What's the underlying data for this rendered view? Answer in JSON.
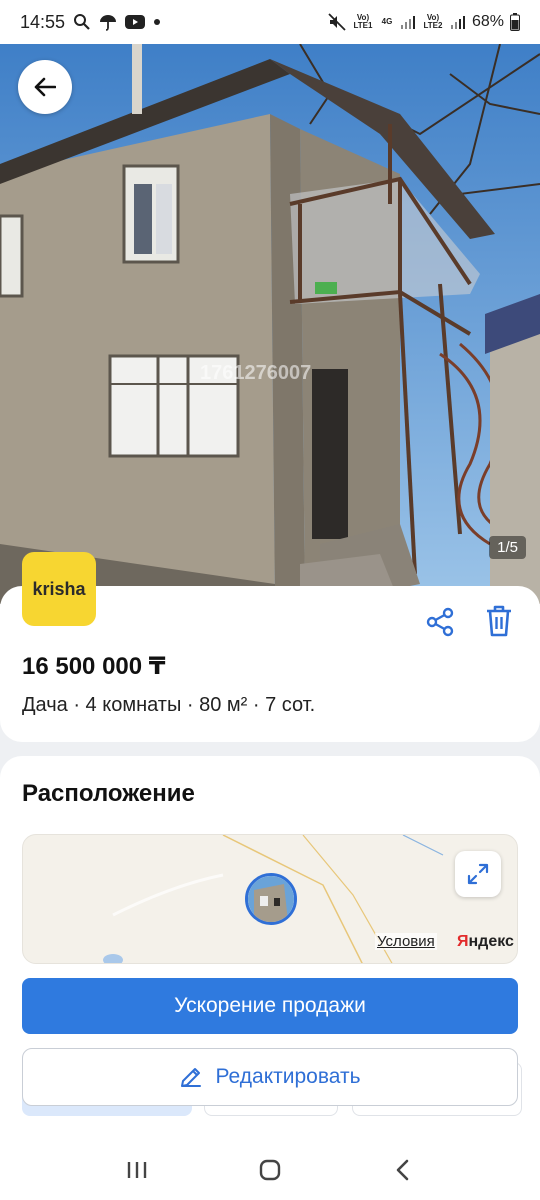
{
  "status_bar": {
    "time": "14:55",
    "battery": "68%",
    "sim1_label": "Vo) LTE1",
    "sim2_label": "Vo) LTE2",
    "network_label": "4G"
  },
  "gallery": {
    "counter": "1/5",
    "watermark": "1761276007"
  },
  "listing": {
    "source_logo": "krisha",
    "price": "16 500 000 ₸",
    "details": "Дача · 4 комнаты · 80 м² · 7 сот."
  },
  "location": {
    "title": "Расположение",
    "map_terms": "Условия",
    "map_brand_first": "Я",
    "map_brand_rest": "ндекс"
  },
  "actions": {
    "boost_label": "Ускорение продажи",
    "edit_label": "Редактировать"
  },
  "colors": {
    "accent": "#2f7adf",
    "logo_bg": "#f7d631"
  }
}
